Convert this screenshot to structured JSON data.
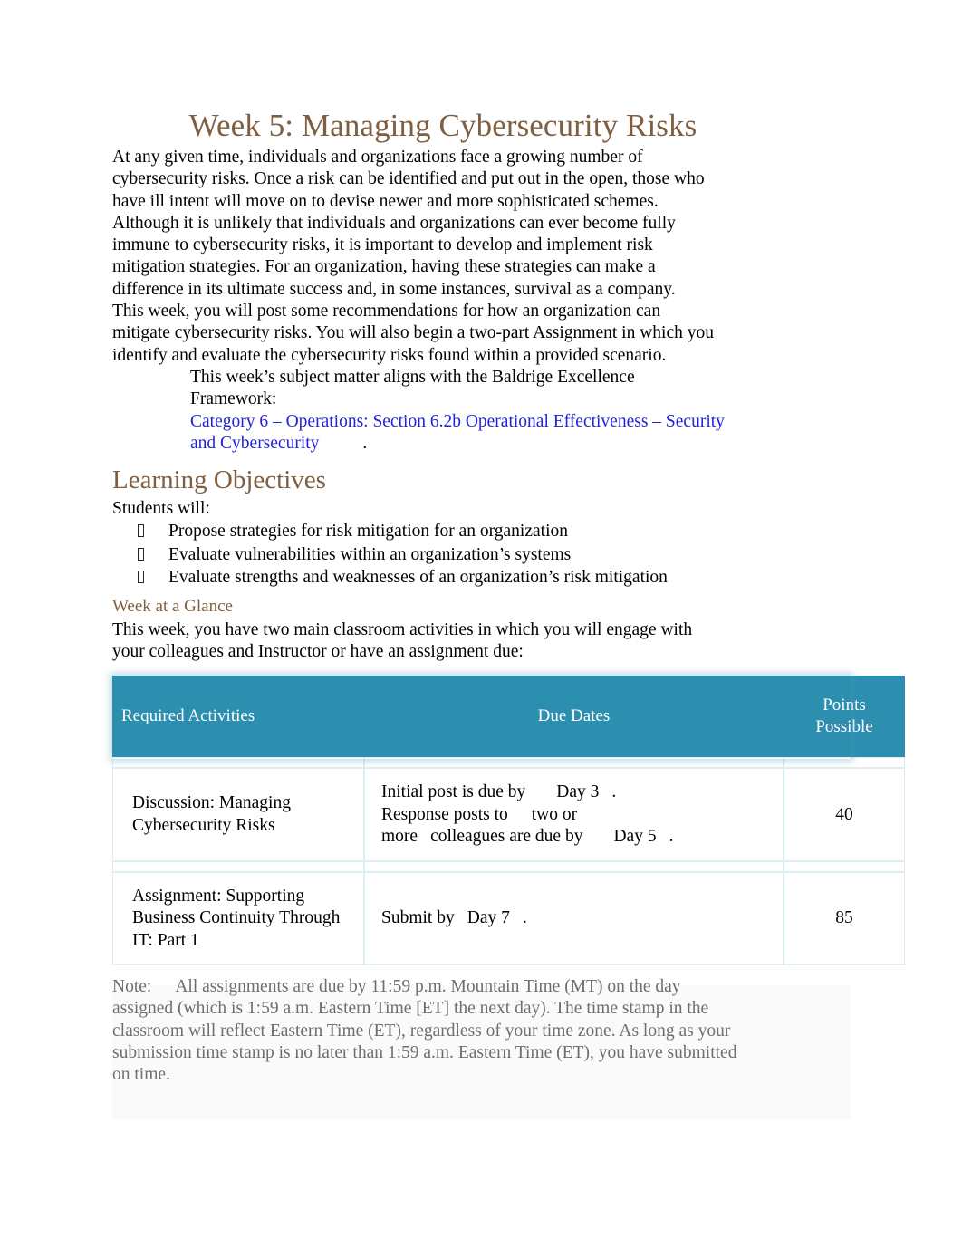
{
  "document": {
    "title": "Week 5: Managing Cybersecurity Risks",
    "colors": {
      "heading_brown": "#7F5F3F",
      "link_blue": "#2222DD",
      "table_header_teal": "#2D8FB0",
      "note_gray": "#6E6E6E",
      "body_black": "#000000"
    }
  },
  "intro": {
    "paragraph_1": "At any given time, individuals and organizations face a growing number of cybersecurity risks. Once a risk can be identified and put out in the open, those who have ill intent will move on to devise newer and more sophisticated schemes. Although it is unlikely that individuals and organizations can ever become fully immune to cybersecurity risks, it is important to develop and implement risk mitigation strategies. For an organization, having these strategies can make a difference in its ultimate success and, in some instances, survival as a company.",
    "paragraph_2": "This week, you will post some recommendations for how an organization can mitigate cybersecurity risks. You will also begin a two-part Assignment in which you identify and evaluate the cybersecurity risks found within a provided scenario.",
    "baldrige_intro": "This week’s subject matter aligns with the Baldrige Excellence Framework:",
    "baldrige_link": "Category 6 – Operations: Section 6.2b Operational Effectiveness – Security and Cybersecurity",
    "baldrige_link_period": "."
  },
  "learning_objectives": {
    "heading": "Learning Objectives",
    "intro": "Students will:",
    "bullet_glyph": "missing-glyph-box",
    "items": [
      "Propose strategies for risk mitigation for an organization",
      "Evaluate vulnerabilities within an organization’s systems",
      "Evaluate strengths and weaknesses of an organization’s risk mitigation"
    ]
  },
  "week_at_a_glance": {
    "heading": "Week at a Glance",
    "intro": "This week, you have two main classroom activities in which you will engage with your colleagues and Instructor or have an assignment due:",
    "table": {
      "headers": [
        "Required Activities",
        "Due Dates",
        "Points Possible"
      ],
      "header_points_line1": "Points",
      "header_points_line2": "Possible",
      "rows": [
        {
          "activity": "Discussion: Managing Cybersecurity Risks",
          "due_lines": [
            {
              "pre": "Initial post is due by",
              "day": "Day 3",
              "post": "."
            },
            {
              "pre": "Response posts to",
              "day": "two or",
              "post": ""
            },
            {
              "pre": "more",
              "day": "colleagues are due by",
              "post": "Day 5",
              "end": "."
            }
          ],
          "points": "40"
        },
        {
          "activity": "Assignment: Supporting Business Continuity Through IT: Part 1",
          "due_lines": [
            {
              "pre": "Submit by",
              "day": "Day 7",
              "post": "."
            }
          ],
          "points": "85"
        }
      ]
    }
  },
  "note": {
    "label": "Note:",
    "text": "All assignments are due by 11:59 p.m. Mountain Time (MT) on the day assigned (which is 1:59 a.m. Eastern Time [ET] the next day). The time stamp in the classroom will reflect Eastern Time (ET), regardless of your time zone. As long as your submission time stamp is no later than 1:59 a.m. Eastern Time (ET), you have submitted on time."
  }
}
